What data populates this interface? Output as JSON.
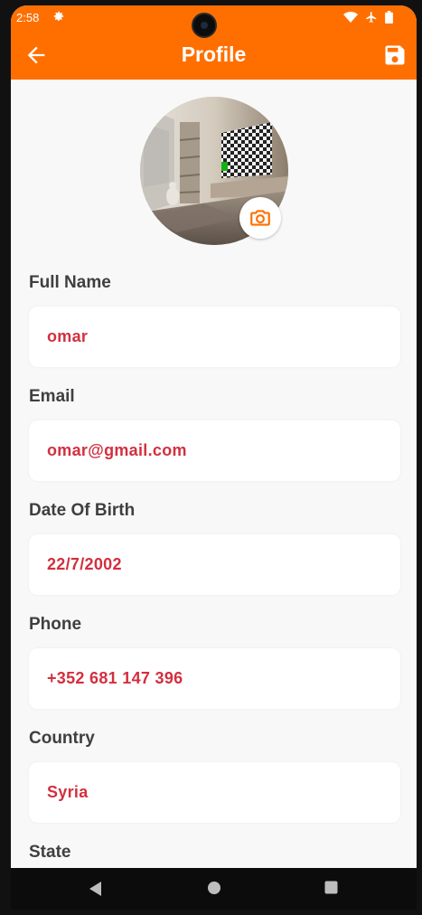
{
  "status_bar": {
    "time": "2:58",
    "icons": [
      "gear-icon",
      "wifi-icon",
      "airplane-icon",
      "battery-icon"
    ]
  },
  "app_bar": {
    "title": "Profile",
    "back_icon": "arrow-left-icon",
    "save_icon": "floppy-disk-icon"
  },
  "avatar": {
    "camera_icon": "camera-icon"
  },
  "fields": [
    {
      "label": "Full Name",
      "value": "omar"
    },
    {
      "label": "Email",
      "value": "omar@gmail.com"
    },
    {
      "label": "Date Of Birth",
      "value": "22/7/2002"
    },
    {
      "label": "Phone",
      "value": "+352 681 147 396"
    },
    {
      "label": "Country",
      "value": "Syria"
    },
    {
      "label": "State",
      "value": ""
    }
  ],
  "nav_bar": {
    "icons": [
      "back-triangle-icon",
      "home-circle-icon",
      "recents-square-icon"
    ]
  },
  "colors": {
    "accent": "#ff6f00",
    "value_text": "#d32f3f",
    "label_text": "#3f3f3f",
    "background": "#f8f8f8"
  }
}
